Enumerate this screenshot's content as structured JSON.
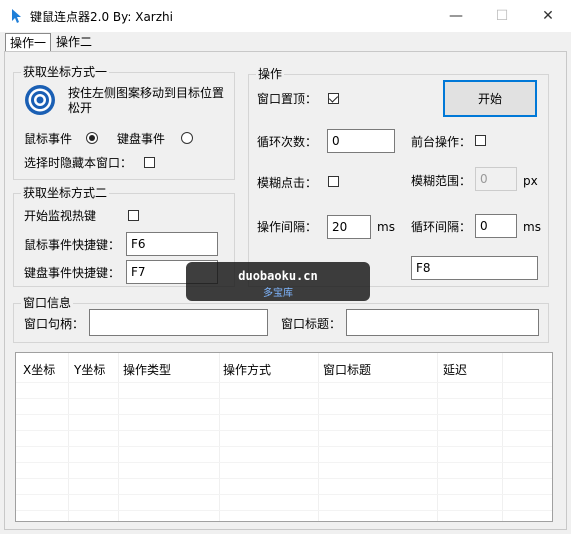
{
  "window": {
    "title": "键鼠连点器2.0 By: Xarzhi",
    "minimize_glyph": "—",
    "maximize_glyph": "☐",
    "close_glyph": "✕"
  },
  "tabs": [
    {
      "label": "操作一",
      "active": true
    },
    {
      "label": "操作二",
      "active": false
    }
  ],
  "group1": {
    "title": "获取坐标方式一",
    "drag_hint": "按住左侧图案移动到目标位置松开",
    "mouse_event_label": "鼠标事件",
    "mouse_event_selected": true,
    "keyboard_event_label": "键盘事件",
    "keyboard_event_selected": false,
    "hide_on_select_label": "选择时隐藏本窗口：",
    "hide_on_select_checked": false
  },
  "group2": {
    "title": "获取坐标方式二",
    "hotkey_monitor_label": "开始监视热键",
    "hotkey_monitor_checked": false,
    "mouse_hotkey_label": "鼠标事件快捷键：",
    "mouse_hotkey_value": "F6",
    "keyboard_hotkey_label": "键盘事件快捷键：",
    "keyboard_hotkey_value": "F7"
  },
  "operation": {
    "title": "操作",
    "topmost_label": "窗口置顶：",
    "topmost_checked": true,
    "start_button": "开始",
    "loop_count_label": "循环次数：",
    "loop_count_value": "0",
    "foreground_label": "前台操作：",
    "foreground_checked": false,
    "fuzzy_click_label": "模糊点击：",
    "fuzzy_click_checked": false,
    "fuzzy_range_label": "模糊范围：",
    "fuzzy_range_value": "0",
    "fuzzy_range_unit": "px",
    "op_interval_label": "操作间隔：",
    "op_interval_value": "20",
    "op_interval_unit": "ms",
    "loop_interval_label": "循环间隔：",
    "loop_interval_value": "0",
    "loop_interval_unit": "ms",
    "hotkey_value": "F8"
  },
  "window_info": {
    "title": "窗口信息",
    "handle_label": "窗口句柄：",
    "handle_value": "",
    "window_title_label": "窗口标题：",
    "window_title_value": ""
  },
  "table": {
    "columns": [
      "X坐标",
      "Y坐标",
      "操作类型",
      "操作方式",
      "窗口标题",
      "延迟"
    ],
    "rows": []
  },
  "watermark": {
    "line1": "duobaoku.cn",
    "line2": "多宝库"
  },
  "colors": {
    "accent": "#0078d7",
    "target_blue": "#1a5fb4"
  }
}
